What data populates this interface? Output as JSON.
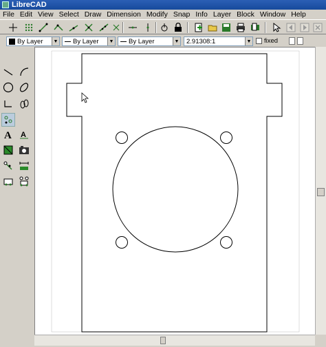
{
  "window": {
    "title": "LibreCAD"
  },
  "menu": [
    "File",
    "Edit",
    "View",
    "Select",
    "Draw",
    "Dimension",
    "Modify",
    "Snap",
    "Info",
    "Layer",
    "Block",
    "Window",
    "Help"
  ],
  "properties": {
    "color": "By Layer",
    "linetype": "By Layer",
    "linewidth": "By Layer",
    "scale": "2.91308:1",
    "fixed_label": "fixed"
  },
  "toolbar_icons": [
    "grid-snap-icon",
    "snap-free-icon",
    "snap-endpoint-icon",
    "snap-center-icon",
    "snap-middle-icon",
    "snap-intersection-icon",
    "snap-distance-icon",
    "restrict-nothing-icon",
    "restrict-horizontal-icon",
    "restrict-vertical-icon",
    "relative-zero-icon",
    "lock-relative-zero-icon",
    "new-document-icon",
    "open-document-icon",
    "save-document-icon",
    "print-icon",
    "print-preview-icon",
    "pointer-icon",
    "back-icon",
    "forward-icon",
    "close-icon"
  ],
  "left_tools": [
    "line-icon",
    "arc-icon",
    "circle-icon",
    "ellipse-icon",
    "polyline-icon",
    "spline-icon",
    "points-icon",
    "text-icon",
    "dimension-icon",
    "hatch-icon",
    "image-icon",
    "move-icon",
    "measure-icon",
    "select-icon",
    "block-icon"
  ],
  "colors": {
    "accent": "#174a9c",
    "panel": "#d4d0c8",
    "canvas": "#ffffff",
    "drawing": "#000000"
  }
}
